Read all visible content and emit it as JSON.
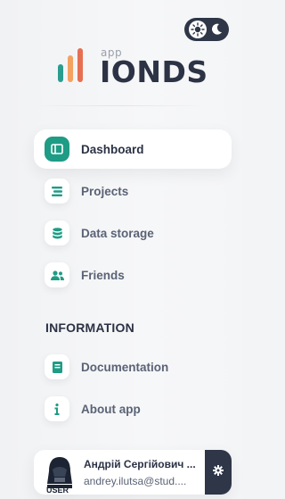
{
  "theme_toggle": {
    "sun_icon": "sun-icon",
    "moon_icon": "moon-icon"
  },
  "logo": {
    "small": "app",
    "name": "IONDS",
    "colors": [
      "#2a9d8f",
      "#f4a261",
      "#e76f51"
    ]
  },
  "nav": {
    "main_items": [
      {
        "label": "Dashboard",
        "icon": "dashboard-icon",
        "active": true
      },
      {
        "label": "Projects",
        "icon": "list-icon",
        "active": false
      },
      {
        "label": "Data storage",
        "icon": "database-icon",
        "active": false
      },
      {
        "label": "Friends",
        "icon": "users-icon",
        "active": false
      }
    ],
    "section_title": "INFORMATION",
    "info_items": [
      {
        "label": "Documentation",
        "icon": "book-icon"
      },
      {
        "label": "About app",
        "icon": "info-icon"
      }
    ]
  },
  "user": {
    "avatar_label": "USER",
    "name": "Андрій Сергійович ...",
    "email": "andrey.ilutsa@stud...."
  },
  "colors": {
    "accent": "#1e9c85",
    "dark": "#2e3648"
  }
}
